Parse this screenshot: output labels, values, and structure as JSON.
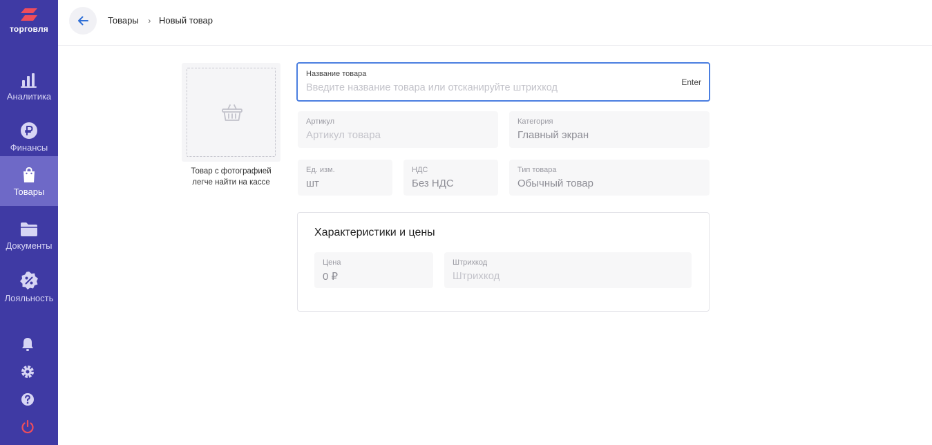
{
  "brand": {
    "name": "торговля",
    "colors": {
      "sidebar": "#3f3aa4",
      "active": "#6e69c7",
      "accent": "#4a7ee0",
      "logo": "#ef4d5b"
    }
  },
  "sidebar": {
    "items": [
      {
        "label": "Аналитика",
        "icon": "bar-chart-icon",
        "active": false
      },
      {
        "label": "Финансы",
        "icon": "ruble-icon",
        "active": false
      },
      {
        "label": "Товары",
        "icon": "shopping-bag-icon",
        "active": true
      },
      {
        "label": "Документы",
        "icon": "folder-icon",
        "active": false
      },
      {
        "label": "Лояльность",
        "icon": "discount-badge-icon",
        "active": false
      }
    ],
    "bottom_icons": [
      "bell-icon",
      "gear-icon",
      "help-icon",
      "power-icon"
    ]
  },
  "header": {
    "breadcrumb": {
      "parent": "Товары",
      "current": "Новый товар"
    }
  },
  "photo": {
    "hint": "Товар с фотографией легче найти на кассе",
    "icon": "basket-icon"
  },
  "form": {
    "name": {
      "label": "Название товара",
      "placeholder": "Введите название товара или отсканируйте штрихкод",
      "hint": "Enter"
    },
    "sku": {
      "label": "Артикул",
      "placeholder": "Артикул товара"
    },
    "category": {
      "label": "Категория",
      "value": "Главный экран"
    },
    "unit": {
      "label": "Ед. изм.",
      "value": "шт"
    },
    "vat": {
      "label": "НДС",
      "value": "Без НДС"
    },
    "type": {
      "label": "Тип товара",
      "value": "Обычный товар"
    }
  },
  "prices": {
    "title": "Характеристики и цены",
    "price": {
      "label": "Цена",
      "value": "0 ₽"
    },
    "barcode": {
      "label": "Штрихкод",
      "placeholder": "Штрихкод"
    }
  }
}
